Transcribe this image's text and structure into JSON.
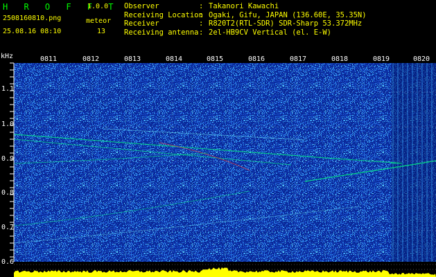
{
  "app": {
    "brand": "H R O F F T",
    "version": "1.0.0",
    "filename": "2508160810.png",
    "datetime": "25.08.16 08:10",
    "meteor_label": "meteor",
    "meteor_count": "13"
  },
  "info": [
    {
      "key": "Observer",
      "sep": ":",
      "value": "Takanori Kawachi"
    },
    {
      "key": "Receiving Location",
      "sep": ":",
      "value": "Ogaki, Gifu, JAPAN (136.60E, 35.35N)"
    },
    {
      "key": "Receiver",
      "sep": ":",
      "value": "R820T2(RTL-SDR) SDR-Sharp 53.372MHz"
    },
    {
      "key": "Receiving antenna",
      "sep": ":",
      "value": "2el-HB9CV Vertical (el. E-W)"
    }
  ],
  "spectrogram": {
    "ylabel": "kHz",
    "yticks": [
      "1.1",
      "1.0",
      "0.9",
      "0.8",
      "0.7",
      "0.6"
    ],
    "xticks": [
      "0811",
      "0812",
      "0813",
      "0814",
      "0815",
      "0816",
      "0817",
      "0818",
      "0819",
      "0820"
    ],
    "colors": {
      "background": "#0a2a9a",
      "noise_low": "#1c55d8",
      "noise_mid": "#3aa7ff",
      "noise_high": "#6ff0ff",
      "signal": "#00ff80",
      "hot": "#ff4030",
      "amplitude": "#ffff00"
    }
  }
}
